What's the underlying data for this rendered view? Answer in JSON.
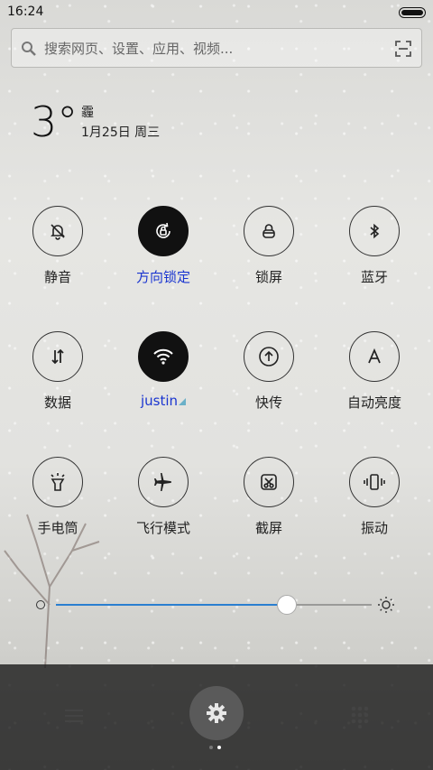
{
  "status_bar": {
    "time": "16:24"
  },
  "search": {
    "placeholder": "搜索网页、设置、应用、视频..."
  },
  "weather": {
    "temperature": "3°",
    "condition": "霾",
    "date": "1月25日 周三"
  },
  "toggles": [
    {
      "label": "静音",
      "icon": "bell-off-icon",
      "on": false
    },
    {
      "label": "方向锁定",
      "icon": "rotation-lock-icon",
      "on": true
    },
    {
      "label": "锁屏",
      "icon": "lock-icon",
      "on": false
    },
    {
      "label": "蓝牙",
      "icon": "bluetooth-icon",
      "on": false
    },
    {
      "label": "数据",
      "icon": "data-arrows-icon",
      "on": false
    },
    {
      "label": "justin",
      "icon": "wifi-icon",
      "on": true
    },
    {
      "label": "快传",
      "icon": "upload-icon",
      "on": false
    },
    {
      "label": "自动亮度",
      "icon": "auto-brightness-icon",
      "on": false
    },
    {
      "label": "手电筒",
      "icon": "flashlight-icon",
      "on": false
    },
    {
      "label": "飞行模式",
      "icon": "airplane-icon",
      "on": false
    },
    {
      "label": "截屏",
      "icon": "screenshot-icon",
      "on": false
    },
    {
      "label": "振动",
      "icon": "vibrate-icon",
      "on": false
    }
  ],
  "brightness": {
    "value": 0.73
  },
  "colors": {
    "active_label": "#1a35d0",
    "slider_fill": "#2a7fd0"
  },
  "pager": {
    "pages": 2,
    "current": 2
  }
}
